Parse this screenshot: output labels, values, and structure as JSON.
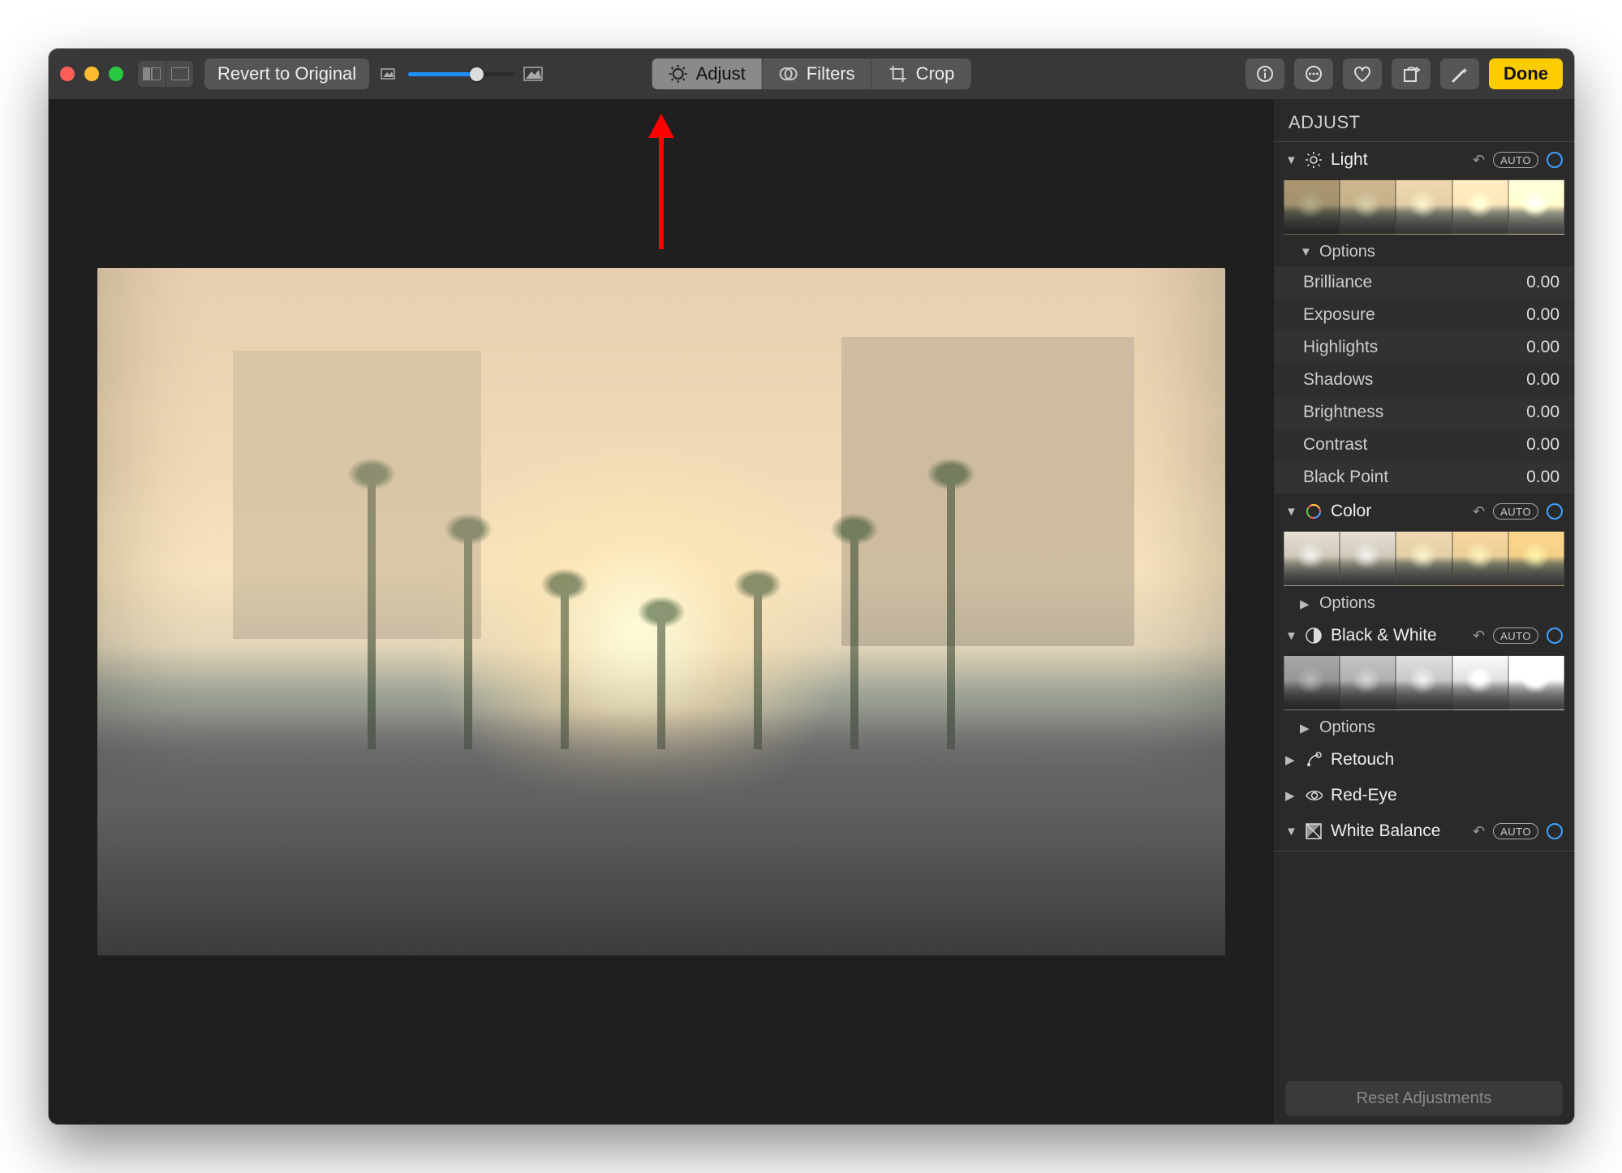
{
  "toolbar": {
    "revert_label": "Revert to Original",
    "tabs": {
      "adjust": "Adjust",
      "filters": "Filters",
      "crop": "Crop"
    },
    "done_label": "Done"
  },
  "panel": {
    "title": "ADJUST",
    "auto_label": "AUTO",
    "options_label": "Options",
    "reset_label": "Reset Adjustments",
    "sections": {
      "light": {
        "label": "Light",
        "rows": [
          {
            "name": "Brilliance",
            "value": "0.00"
          },
          {
            "name": "Exposure",
            "value": "0.00"
          },
          {
            "name": "Highlights",
            "value": "0.00"
          },
          {
            "name": "Shadows",
            "value": "0.00"
          },
          {
            "name": "Brightness",
            "value": "0.00"
          },
          {
            "name": "Contrast",
            "value": "0.00"
          },
          {
            "name": "Black Point",
            "value": "0.00"
          }
        ]
      },
      "color": {
        "label": "Color"
      },
      "bw": {
        "label": "Black & White"
      },
      "retouch": {
        "label": "Retouch"
      },
      "redeye": {
        "label": "Red-Eye"
      },
      "wb": {
        "label": "White Balance"
      }
    }
  }
}
